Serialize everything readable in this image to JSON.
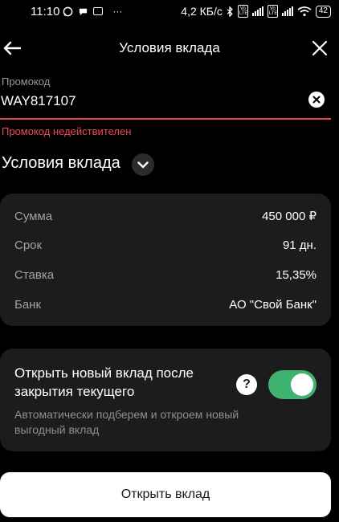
{
  "status_bar": {
    "time": "11:10",
    "network_speed": "4,2 КБ/с",
    "battery": "42",
    "more": "···",
    "volte_label": "Vo LTE"
  },
  "header": {
    "title": "Условия вклада"
  },
  "promo": {
    "label": "Промокод",
    "value": "WAY817107",
    "error": "Промокод недействителен"
  },
  "conditions": {
    "title": "Условия вклада",
    "rows": [
      {
        "label": "Сумма",
        "value": "450 000 ₽"
      },
      {
        "label": "Срок",
        "value": "91 дн."
      },
      {
        "label": "Ставка",
        "value": "15,35%"
      },
      {
        "label": "Банк",
        "value": "АО \"Свой Банк\""
      }
    ]
  },
  "auto_renew": {
    "title": "Открыть новый вклад после закрытия текущего",
    "description": "Автоматически подберем и откроем новый выгодный вклад",
    "help": "?",
    "enabled": true
  },
  "actions": {
    "open_label": "Открыть вклад"
  },
  "colors": {
    "background": "#000000",
    "card": "#1c1c1e",
    "error": "#ef4a4f",
    "toggle_on": "#3fb26f"
  }
}
